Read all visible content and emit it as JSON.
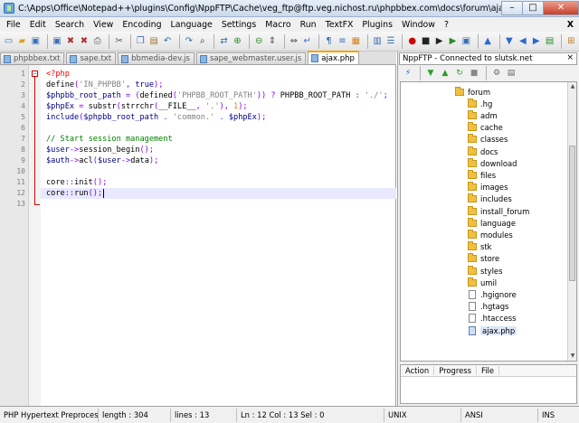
{
  "window": {
    "title": "C:\\Apps\\Office\\Notepad++\\plugins\\Config\\NppFTP\\Cache\\veg_ftp@ftp.veg.nichost.ru\\phpbbex.com\\docs\\forum\\ajax.php - Notepad++",
    "minimize": "–",
    "maximize": "□",
    "close": "✕"
  },
  "menu": {
    "items": [
      "File",
      "Edit",
      "Search",
      "View",
      "Encoding",
      "Language",
      "Settings",
      "Macro",
      "Run",
      "TextFX",
      "Plugins",
      "Window",
      "?"
    ],
    "close_label": "X"
  },
  "toolbar": {
    "icons": [
      "new-file-icon",
      "open-file-icon",
      "save-icon",
      "save-all-icon",
      "close-icon",
      "close-all-icon",
      "print-icon",
      "cut-icon",
      "copy-icon",
      "paste-icon",
      "undo-icon",
      "redo-icon",
      "find-icon",
      "replace-icon",
      "zoom-in-icon",
      "zoom-out-icon",
      "sync-vertical-icon",
      "sync-horizontal-icon",
      "word-wrap-icon",
      "all-chars-icon",
      "indent-guide-icon",
      "user-lang-icon",
      "doc-map-icon",
      "function-list-icon",
      "record-macro-icon",
      "stop-macro-icon",
      "play-macro-icon",
      "run-macro-icon",
      "save-macro-icon",
      "up-icon",
      "down-icon",
      "left-icon",
      "right-icon",
      "tree-icon",
      "ftp-icon"
    ]
  },
  "tabs": [
    {
      "label": "phpbbex.txt",
      "active": false
    },
    {
      "label": "sape.txt",
      "active": false
    },
    {
      "label": "bbmedia-dev.js",
      "active": false
    },
    {
      "label": "sape_webmaster.user.js",
      "active": false
    },
    {
      "label": "ajax.php",
      "active": true
    }
  ],
  "editor": {
    "current_line": 12,
    "lines": [
      {
        "num": "1",
        "tokens": [
          {
            "t": "<?php",
            "c": "ph"
          }
        ]
      },
      {
        "num": "2",
        "tokens": [
          {
            "t": "define",
            "c": "d"
          },
          {
            "t": "(",
            "c": "o"
          },
          {
            "t": "'IN_PHPBB'",
            "c": "s"
          },
          {
            "t": ", ",
            "c": "o"
          },
          {
            "t": "true",
            "c": "k"
          },
          {
            "t": ");",
            "c": "o"
          }
        ]
      },
      {
        "num": "3",
        "tokens": [
          {
            "t": "$phpbb_root_path",
            "c": "v"
          },
          {
            "t": " = (",
            "c": "o"
          },
          {
            "t": "defined",
            "c": "d"
          },
          {
            "t": "(",
            "c": "o"
          },
          {
            "t": "'PHPBB_ROOT_PATH'",
            "c": "s"
          },
          {
            "t": ")) ? ",
            "c": "o"
          },
          {
            "t": "PHPBB_ROOT_PATH",
            "c": "d"
          },
          {
            "t": " : ",
            "c": "o"
          },
          {
            "t": "'./'",
            "c": "s"
          },
          {
            "t": ";",
            "c": "o"
          }
        ]
      },
      {
        "num": "4",
        "tokens": [
          {
            "t": "$phpEx",
            "c": "v"
          },
          {
            "t": " = ",
            "c": "o"
          },
          {
            "t": "substr",
            "c": "d"
          },
          {
            "t": "(",
            "c": "o"
          },
          {
            "t": "strrchr",
            "c": "d"
          },
          {
            "t": "(",
            "c": "o"
          },
          {
            "t": "__FILE__",
            "c": "d"
          },
          {
            "t": ", ",
            "c": "o"
          },
          {
            "t": "'.'",
            "c": "s"
          },
          {
            "t": "), ",
            "c": "o"
          },
          {
            "t": "1",
            "c": "n"
          },
          {
            "t": ");",
            "c": "o"
          }
        ]
      },
      {
        "num": "5",
        "tokens": [
          {
            "t": "include",
            "c": "k"
          },
          {
            "t": "(",
            "c": "o"
          },
          {
            "t": "$phpbb_root_path",
            "c": "v"
          },
          {
            "t": " . ",
            "c": "o"
          },
          {
            "t": "'common.'",
            "c": "s"
          },
          {
            "t": " . ",
            "c": "o"
          },
          {
            "t": "$phpEx",
            "c": "v"
          },
          {
            "t": ");",
            "c": "o"
          }
        ]
      },
      {
        "num": "6",
        "tokens": []
      },
      {
        "num": "7",
        "tokens": [
          {
            "t": "// Start session management",
            "c": "c"
          }
        ]
      },
      {
        "num": "8",
        "tokens": [
          {
            "t": "$user",
            "c": "v"
          },
          {
            "t": "->",
            "c": "o"
          },
          {
            "t": "session_begin",
            "c": "d"
          },
          {
            "t": "();",
            "c": "o"
          }
        ]
      },
      {
        "num": "9",
        "tokens": [
          {
            "t": "$auth",
            "c": "v"
          },
          {
            "t": "->",
            "c": "o"
          },
          {
            "t": "acl",
            "c": "d"
          },
          {
            "t": "(",
            "c": "o"
          },
          {
            "t": "$user",
            "c": "v"
          },
          {
            "t": "->",
            "c": "o"
          },
          {
            "t": "data",
            "c": "d"
          },
          {
            "t": ");",
            "c": "o"
          }
        ]
      },
      {
        "num": "10",
        "tokens": []
      },
      {
        "num": "11",
        "tokens": [
          {
            "t": "core",
            "c": "d"
          },
          {
            "t": "::",
            "c": "o"
          },
          {
            "t": "init",
            "c": "d"
          },
          {
            "t": "();",
            "c": "o"
          }
        ]
      },
      {
        "num": "12",
        "tokens": [
          {
            "t": "core",
            "c": "d"
          },
          {
            "t": "::",
            "c": "o"
          },
          {
            "t": "run",
            "c": "d"
          },
          {
            "t": "();",
            "c": "o"
          }
        ]
      },
      {
        "num": "13",
        "tokens": []
      }
    ]
  },
  "ftp_panel": {
    "title": "NppFTP - Connected to slutsk.net",
    "close": "×",
    "tree": [
      {
        "label": "forum",
        "type": "folder",
        "level": 0
      },
      {
        "label": ".hg",
        "type": "folder",
        "level": 1
      },
      {
        "label": "adm",
        "type": "folder",
        "level": 1
      },
      {
        "label": "cache",
        "type": "folder",
        "level": 1
      },
      {
        "label": "classes",
        "type": "folder",
        "level": 1
      },
      {
        "label": "docs",
        "type": "folder",
        "level": 1
      },
      {
        "label": "download",
        "type": "folder",
        "level": 1
      },
      {
        "label": "files",
        "type": "folder",
        "level": 1
      },
      {
        "label": "images",
        "type": "folder",
        "level": 1
      },
      {
        "label": "includes",
        "type": "folder",
        "level": 1
      },
      {
        "label": "install_forum",
        "type": "folder",
        "level": 1
      },
      {
        "label": "language",
        "type": "folder",
        "level": 1
      },
      {
        "label": "modules",
        "type": "folder",
        "level": 1
      },
      {
        "label": "stk",
        "type": "folder",
        "level": 1
      },
      {
        "label": "store",
        "type": "folder",
        "level": 1
      },
      {
        "label": "styles",
        "type": "folder",
        "level": 1
      },
      {
        "label": "umil",
        "type": "folder",
        "level": 1
      },
      {
        "label": ".hgignore",
        "type": "file",
        "level": 1
      },
      {
        "label": ".hgtags",
        "type": "file",
        "level": 1
      },
      {
        "label": ".htaccess",
        "type": "file",
        "level": 1
      },
      {
        "label": "ajax.php",
        "type": "php",
        "level": 1
      }
    ],
    "queue_headers": [
      "Action",
      "Progress",
      "File"
    ]
  },
  "status": {
    "lang": "PHP Hypertext Preprocessor",
    "length": "length : 304",
    "lines": "lines : 13",
    "position": "Ln : 12    Col : 13    Sel : 0",
    "eol": "UNIX",
    "encoding": "ANSI",
    "mode": "INS"
  }
}
